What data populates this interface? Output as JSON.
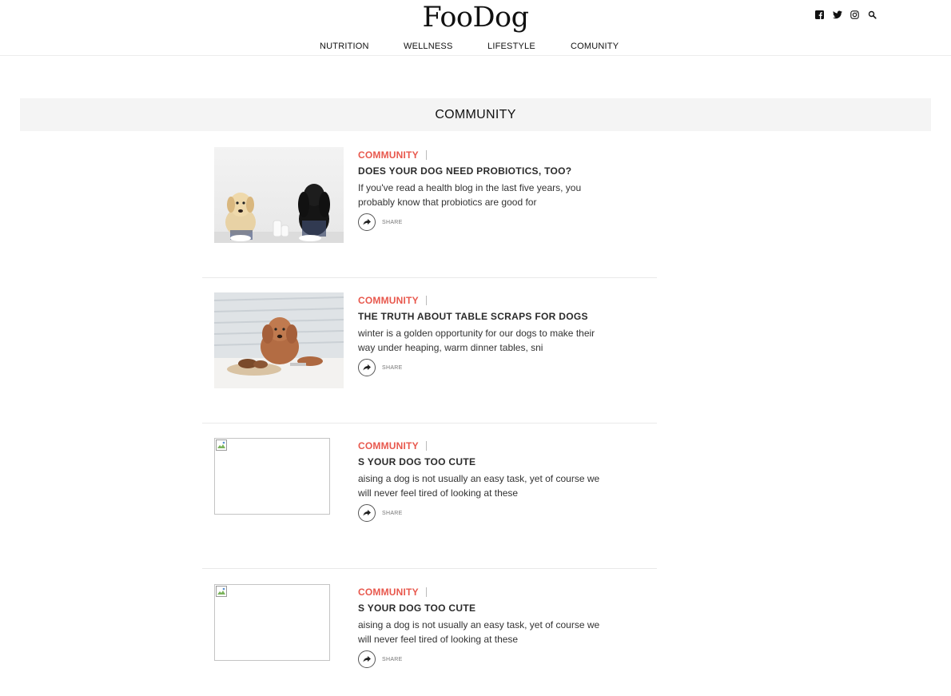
{
  "header": {
    "logo": "FooDog",
    "nav": [
      "NUTRITION",
      "WELLNESS",
      "LIFESTYLE",
      "COMUNITY"
    ],
    "social_icons": [
      "facebook-icon",
      "twitter-icon",
      "instagram-icon",
      "search-icon"
    ]
  },
  "banner": {
    "title": "COMMUNITY"
  },
  "articles": [
    {
      "category": "COMMUNITY",
      "title": "DOES YOUR DOG NEED PROBIOTICS, TOO?",
      "excerpt": "If you've read a health blog in the last five years, you probably know that probiotics are good for",
      "share_label": "SHARE",
      "image": "two-dogs-with-milk"
    },
    {
      "category": "COMMUNITY",
      "title": "THE TRUTH ABOUT TABLE SCRAPS FOR DOGS",
      "excerpt": "winter is a golden opportunity for our dogs to make their way under heaping, warm dinner tables, sni",
      "share_label": "SHARE",
      "image": "poodle-with-bread"
    },
    {
      "category": "COMMUNITY",
      "title": "S YOUR DOG TOO CUTE",
      "excerpt": "aising a dog is not usually an easy task, yet of course we will never feel tired of looking at these",
      "share_label": "SHARE",
      "image": "broken-image"
    },
    {
      "category": "COMMUNITY",
      "title": "S YOUR DOG TOO CUTE",
      "excerpt": "aising a dog is not usually an easy task, yet of course we will never feel tired of looking at these",
      "share_label": "SHARE",
      "image": "broken-image"
    }
  ],
  "colors": {
    "accent": "#e8584d",
    "banner_bg": "#f4f4f4",
    "divider": "#e9e9e9"
  }
}
